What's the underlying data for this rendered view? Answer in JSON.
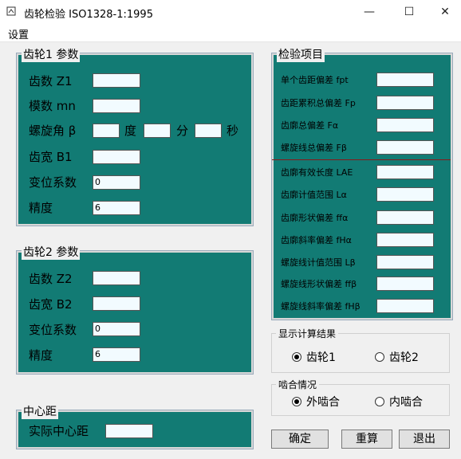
{
  "window": {
    "title": "齿轮检验 ISO1328-1:1995",
    "controls": {
      "minimize": "—",
      "maximize": "☐",
      "close": "✕"
    }
  },
  "menu": {
    "settings": "设置"
  },
  "gear1": {
    "legend": "齿轮1 参数",
    "teeth_label": "齿数 Z1",
    "teeth_value": "",
    "module_label": "模数 mn",
    "module_value": "",
    "helix_label": "螺旋角 β",
    "deg": "度",
    "min": "分",
    "sec": "秒",
    "width_label": "齿宽 B1",
    "width_value": "",
    "shift_label": "变位系数",
    "shift_value": "0",
    "precision_label": "精度",
    "precision_value": "6"
  },
  "gear2": {
    "legend": "齿轮2 参数",
    "teeth_label": "齿数 Z2",
    "teeth_value": "",
    "width_label": "齿宽 B2",
    "width_value": "",
    "shift_label": "变位系数",
    "shift_value": "0",
    "precision_label": "精度",
    "precision_value": "6"
  },
  "center": {
    "legend": "中心距",
    "actual_label": "实际中心距",
    "actual_value": ""
  },
  "inspection": {
    "legend": "检验项目",
    "items": [
      "单个齿距偏差 fpt",
      "齿距累积总偏差 Fp",
      "齿廓总偏差 Fα",
      "螺旋线总偏差 Fβ",
      "齿廓有效长度 LAE",
      "齿廓计值范围 Lα",
      "齿廓形状偏差 ffα",
      "齿廓斜率偏差 fHα",
      "螺旋线计值范围 Lβ",
      "螺旋线形状偏差 ffβ",
      "螺旋线斜率偏差 fHβ"
    ]
  },
  "display": {
    "legend": "显示计算结果",
    "opt1": "齿轮1",
    "opt2": "齿轮2"
  },
  "mesh": {
    "legend": "啮合情况",
    "opt1": "外啮合",
    "opt2": "内啮合"
  },
  "buttons": {
    "ok": "确定",
    "reset": "重算",
    "exit": "退出"
  }
}
